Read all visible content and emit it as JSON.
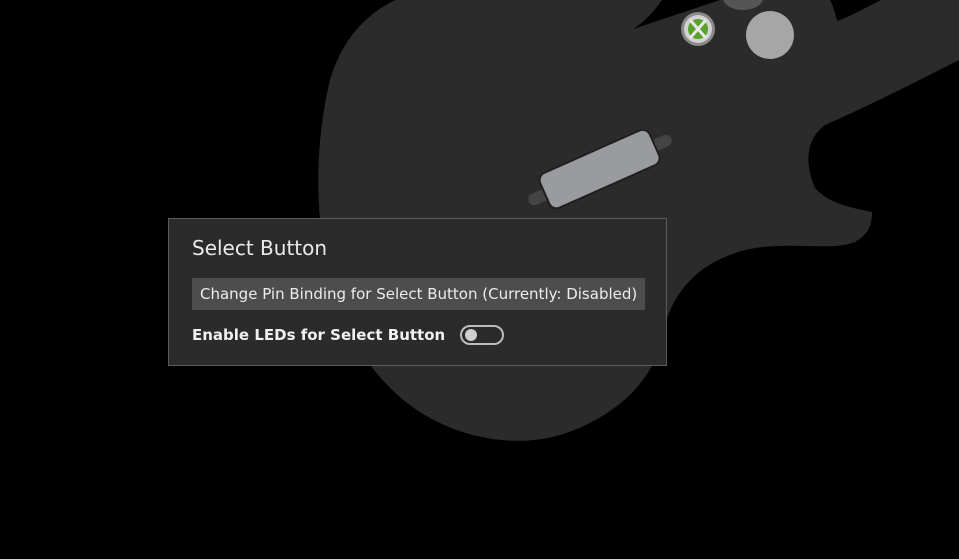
{
  "dialog": {
    "title": "Select Button",
    "pin_button_label": "Change Pin Binding for Select Button (Currently: Disabled)",
    "led_label": "Enable LEDs for Select Button",
    "led_enabled": false
  },
  "background": {
    "guitar_body_color": "#2b2b2b",
    "button_colors": {
      "xbox_button": "#c8c8c8",
      "xbox_logo": "#5aa02c",
      "round_button": "#a6a6a6",
      "strum_bar": "#9a9a9a"
    },
    "icons": [
      "xbox-guide-button-icon",
      "round-face-button-icon",
      "strum-bar-icon"
    ]
  }
}
